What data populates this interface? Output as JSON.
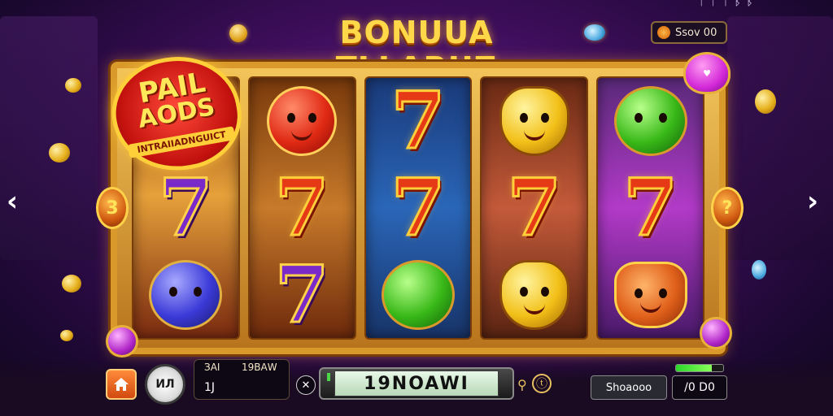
{
  "title": "BONUUA TLLARUZ",
  "top_status": "ᛘ ᛚ ᛘ ᛒ ᛒ",
  "balance": {
    "label": "Ssov 00",
    "icon": "coin-icon"
  },
  "promo_badge": {
    "line1": "PAIL",
    "line2": "AODS",
    "subtitle": "INTRAIIADNGUICT"
  },
  "heart_badge": {
    "icon": "heart-icon"
  },
  "side_left": "3",
  "side_right": "?",
  "reels": [
    {
      "id": "reel-1",
      "symbols": [
        "promo",
        "seven",
        "blue-orb"
      ]
    },
    {
      "id": "reel-2",
      "symbols": [
        "red-angry",
        "seven",
        "seven-purple"
      ]
    },
    {
      "id": "reel-3",
      "symbols": [
        "seven",
        "seven",
        "green-orb"
      ]
    },
    {
      "id": "reel-4",
      "symbols": [
        "yellow-bell",
        "seven",
        "yellow-face"
      ]
    },
    {
      "id": "reel-5",
      "symbols": [
        "green-hat",
        "seven",
        "cat"
      ]
    }
  ],
  "seven_glyph": "7",
  "nav": {
    "left": "‹",
    "right": "›"
  },
  "bottom": {
    "home_icon": "home-icon",
    "info_label": "ИЛ",
    "bet_label": "ЗАI",
    "bet_label2": "19ВАW",
    "bet_value": "1J",
    "close_label": "✕",
    "spin_display": "19NOAWI",
    "icon_a": "⚲",
    "icon_b": "ⓣ",
    "showdown_label": "Shoaooo",
    "win_value": "/0 D0",
    "win_meter_level": 0.75
  }
}
